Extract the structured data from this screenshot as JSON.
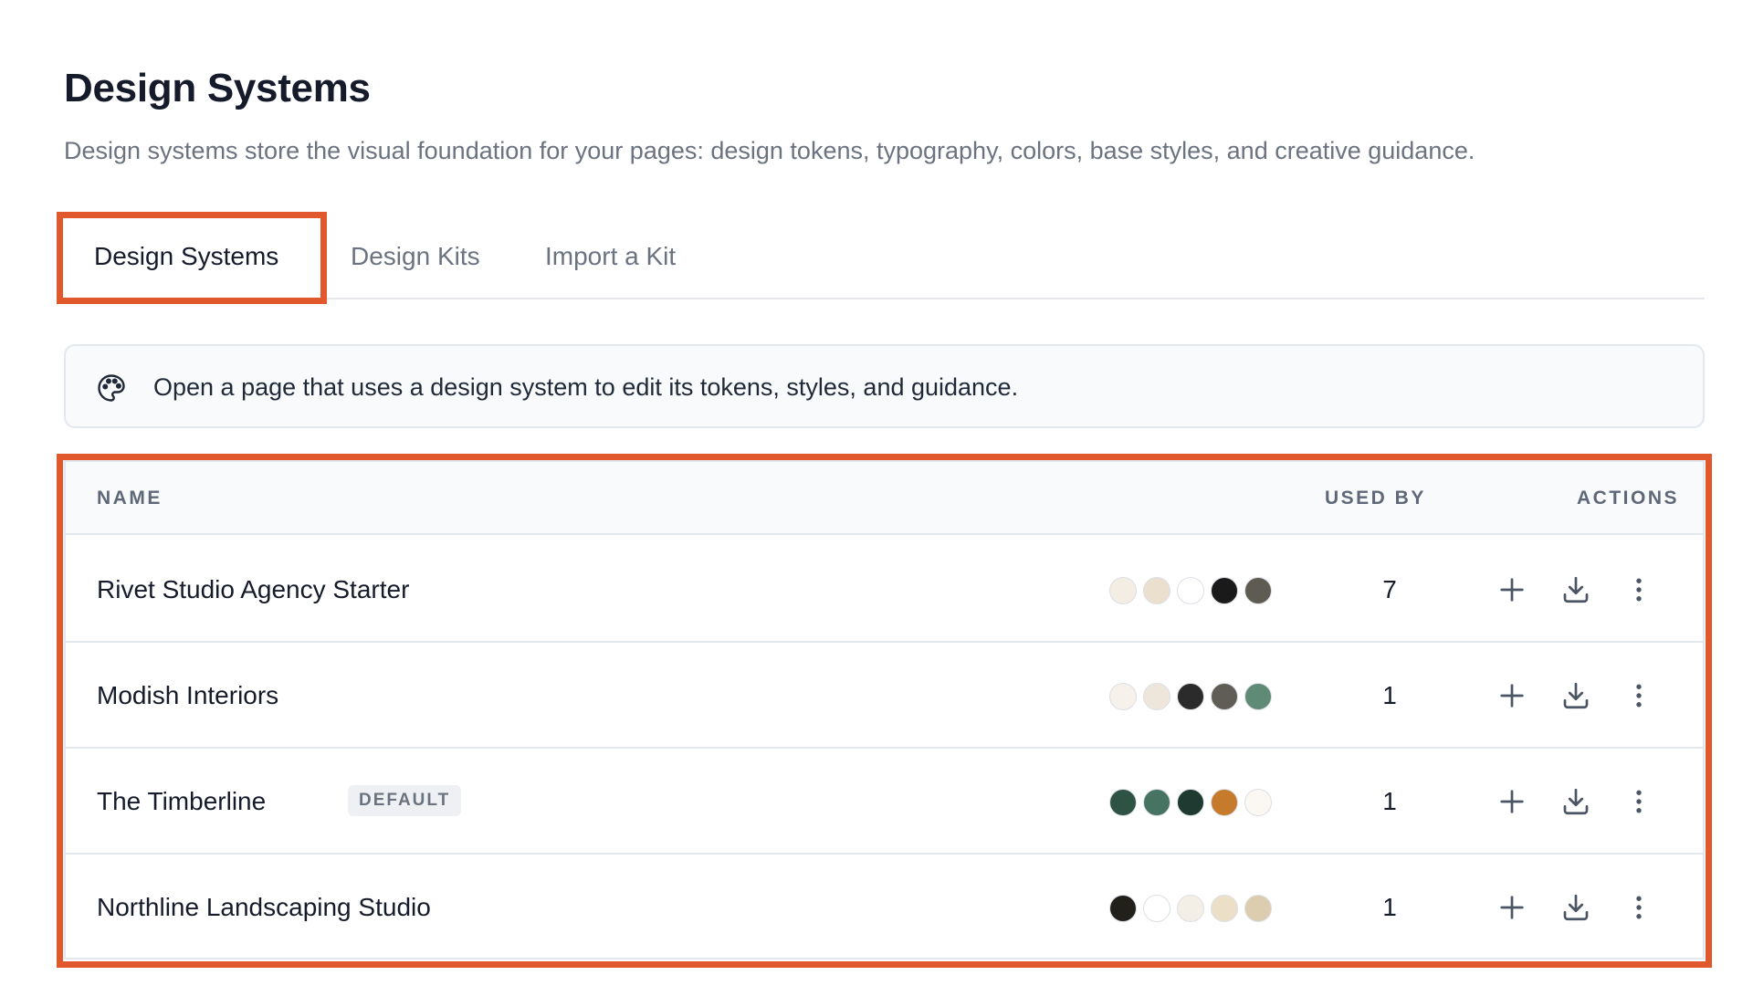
{
  "page": {
    "title": "Design Systems",
    "subtitle": "Design systems store the visual foundation for your pages: design tokens, typography, colors, base styles, and creative guidance."
  },
  "tabs": [
    {
      "label": "Design Systems",
      "active": true
    },
    {
      "label": "Design Kits",
      "active": false
    },
    {
      "label": "Import a Kit",
      "active": false
    }
  ],
  "info": {
    "icon": "palette-icon",
    "text": "Open a page that uses a design system to edit its tokens, styles, and guidance."
  },
  "table": {
    "headers": {
      "name": "NAME",
      "used_by": "USED BY",
      "actions": "ACTIONS"
    },
    "rows": [
      {
        "name": "Rivet Studio Agency Starter",
        "badge": "",
        "used_by": "7",
        "colors": [
          "#f4ede3",
          "#ebdfcd",
          "#ffffff",
          "#1a1a1a",
          "#5e5b52"
        ]
      },
      {
        "name": "Modish Interiors",
        "badge": "",
        "used_by": "1",
        "colors": [
          "#f6f1ea",
          "#eee6da",
          "#2b2b2b",
          "#605d56",
          "#5e8a76"
        ]
      },
      {
        "name": "The Timberline",
        "badge": "DEFAULT",
        "used_by": "1",
        "colors": [
          "#2e5244",
          "#477362",
          "#1f3a30",
          "#c67b2c",
          "#fbf8f3"
        ]
      },
      {
        "name": "Northline Landscaping Studio",
        "badge": "",
        "used_by": "1",
        "colors": [
          "#22201b",
          "#ffffff",
          "#f4efe6",
          "#ebdfc8",
          "#dccdb0"
        ]
      }
    ],
    "action_icons": [
      "plus-icon",
      "download-icon",
      "more-vertical-icon"
    ]
  },
  "colors": {
    "highlight": "#e0582b",
    "tab_underline": "#2f8e86"
  }
}
